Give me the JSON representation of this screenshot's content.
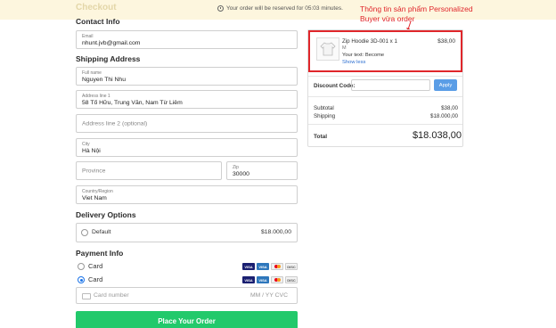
{
  "banner": {
    "brand": "Checkout",
    "timer_text": "Your order will be reserved for 05:03 minutes."
  },
  "contact": {
    "title": "Contact Info",
    "email_label": "Email",
    "email_value": "nhunt.jvb@gmail.com"
  },
  "shipping": {
    "title": "Shipping Address",
    "fullname_label": "Full name",
    "fullname_value": "Nguyen Thi Nhu",
    "address1_label": "Address line 1",
    "address1_value": "58 Tố Hữu, Trung Văn, Nam Từ Liêm",
    "address2_placeholder": "Address line 2 (optional)",
    "city_label": "City",
    "city_value": "Hà Nội",
    "province_placeholder": "Province",
    "zip_label": "Zip",
    "zip_value": "30000",
    "country_label": "Country/Region",
    "country_value": "Viet Nam"
  },
  "delivery": {
    "title": "Delivery Options",
    "option_label": "Default",
    "option_price": "$18.000,00"
  },
  "payment": {
    "title": "Payment Info",
    "method1_label": "Card",
    "method2_label": "Card",
    "card_number_placeholder": "Card number",
    "exp_cvc_placeholder": "MM / YY  CVC",
    "card_brands": [
      "VISA",
      "VISA",
      "MC",
      "DISC"
    ]
  },
  "place_order_label": "Place Your Order",
  "annotation": {
    "text": "Thông tin sản phẩm Personalized Buyer vừa order",
    "color": "#e0262b"
  },
  "summary": {
    "product_name": "Zip Hoodie 3D-001 x 1",
    "product_variant": "M",
    "product_text": "Your text: Become",
    "show_less": "Show less",
    "product_price": "$38,00",
    "discount_label": "Discount Code:",
    "apply_label": "Apply",
    "subtotal_label": "Subtotal",
    "subtotal_value": "$38,00",
    "shipping_label": "Shipping",
    "shipping_value": "$18.000,00",
    "total_label": "Total",
    "total_value": "$18.038,00"
  },
  "colors": {
    "accent_green": "#22c96b",
    "apply_blue": "#5a9de6",
    "highlight_red": "#e0262b",
    "banner_bg": "#fdf6de"
  }
}
